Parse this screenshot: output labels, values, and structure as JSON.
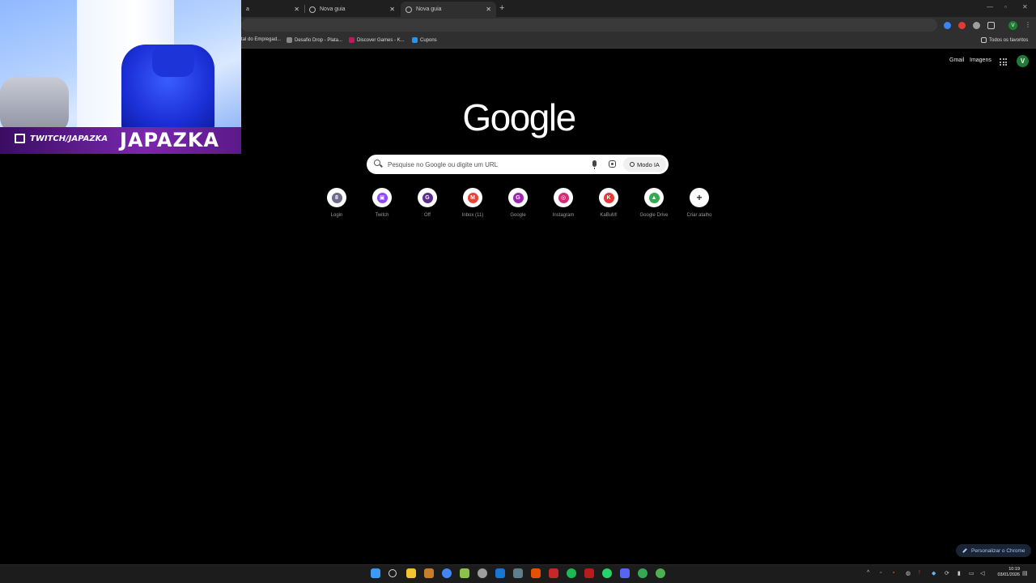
{
  "browser": {
    "tabs": [
      {
        "label": "a",
        "active": false
      },
      {
        "label": "Nova guia",
        "active": false
      },
      {
        "label": "Nova guia",
        "active": true
      }
    ],
    "bookmarks": [
      "tal do Empregad...",
      "Desafio Drop - Plata...",
      "Discover Games - K...",
      "Cupons"
    ],
    "all_bookmarks_label": "Todos os favoritos",
    "profile_initial": "V"
  },
  "ntp": {
    "top_links": {
      "gmail": "Gmail",
      "images": "Imagens"
    },
    "avatar_initial": "V",
    "logo": "Google",
    "search": {
      "placeholder": "Pesquise no Google ou digite um URL",
      "ai_mode_label": "Modo IA"
    },
    "shortcuts": [
      {
        "label": "Login",
        "glyph": "8",
        "color": "#6b6b8a"
      },
      {
        "label": "Twitch",
        "glyph": "▣",
        "color": "#9146ff"
      },
      {
        "label": "Off",
        "glyph": "G",
        "color": "#5c2d91"
      },
      {
        "label": "Inbox (11)",
        "glyph": "M",
        "color": "#ea4335"
      },
      {
        "label": "Google",
        "glyph": "G",
        "color": "#9c27b0"
      },
      {
        "label": "Instagram",
        "glyph": "◎",
        "color": "#d62976"
      },
      {
        "label": "KaBuM!",
        "glyph": "K",
        "color": "#e53935"
      },
      {
        "label": "Google Drive",
        "glyph": "▲",
        "color": "#34a853"
      },
      {
        "label": "Criar atalho",
        "glyph": "+",
        "color": "#444444"
      }
    ],
    "customize_label": "Personalizar o Chrome"
  },
  "overlay": {
    "channel": "TWITCH/JAPAZKA",
    "brand": "JAPAZKA"
  },
  "taskbar": {
    "time": "10:19",
    "date": "03/01/2026"
  },
  "colors": {
    "background": "#000000",
    "avatar": "#1e7d34",
    "twitch_purple": "#7a27b0"
  }
}
